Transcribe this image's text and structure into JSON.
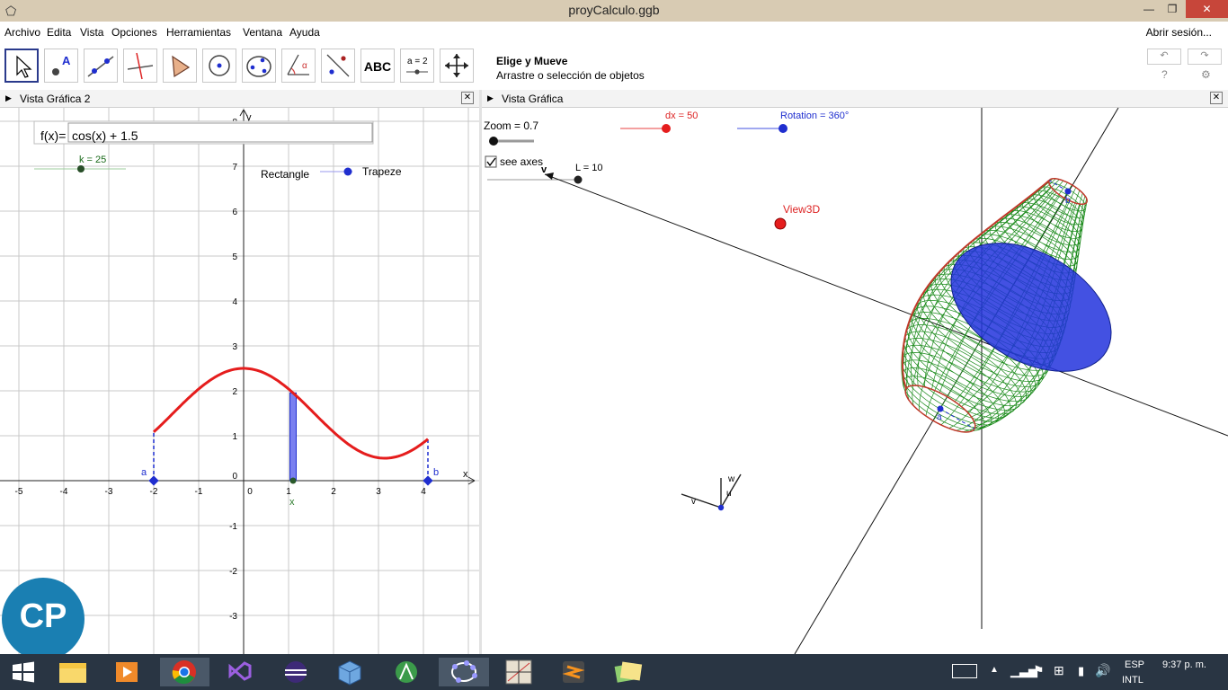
{
  "window": {
    "title": "proyCalculo.ggb",
    "minimize": "—",
    "restore": "❐",
    "close": "✕"
  },
  "menu": {
    "items": [
      "Archivo",
      "Edita",
      "Vista",
      "Opciones",
      "Herramientas",
      "Ventana",
      "Ayuda"
    ],
    "login": "Abrir sesión..."
  },
  "toolbar": {
    "tool_title": "Elige y Mueve",
    "tool_desc": "Arrastre o selección de objetos",
    "text_tool": "ABC",
    "slider_tool": "a = 2",
    "undo": "↶",
    "redo": "↷",
    "help": "?",
    "settings": "⚙"
  },
  "left_view": {
    "header": "Vista Gráfica 2",
    "input_label": "f(x)=",
    "input_value": "cos(x) + 1.5",
    "slider_k": "k = 25",
    "rect_label": "Rectangle",
    "trap_label": "Trapeze",
    "x_axis_name": "x",
    "y_axis_name": "y",
    "x_ticks": [
      "-5",
      "-4",
      "-3",
      "-2",
      "-1",
      "0",
      "1",
      "2",
      "3",
      "4"
    ],
    "y_ticks": [
      "8",
      "7",
      "6",
      "5",
      "4",
      "3",
      "2",
      "1",
      "0",
      "-1",
      "-2",
      "-3"
    ],
    "point_a": "a",
    "point_b": "b",
    "point_x": "x",
    "logo": "CP"
  },
  "right_view": {
    "header": "Vista Gráfica",
    "zoom": "Zoom = 0.7",
    "dx": "dx = 50",
    "rotation": "Rotation = 360°",
    "see_axes": "see axes",
    "L": "L = 10",
    "view3d": "View3D",
    "axis_v": "v",
    "axis_w": "w",
    "axis_u": "u",
    "point_a": "a",
    "point_b": "b"
  },
  "taskbar": {
    "lang1": "ESP",
    "lang2": "INTL",
    "time": "9:37 p. m."
  },
  "chart_data": {
    "type": "line",
    "function": "cos(x) + 1.5",
    "domain": [
      -2,
      4.1
    ],
    "xlim": [
      -5.5,
      5
    ],
    "ylim": [
      -3.5,
      8
    ],
    "series": [
      {
        "values": [
          [
            -2,
            1.08
          ],
          [
            -1.5,
            1.57
          ],
          [
            -1,
            2.04
          ],
          [
            -0.5,
            2.38
          ],
          [
            0,
            2.5
          ],
          [
            0.5,
            2.38
          ],
          [
            1,
            2.04
          ],
          [
            1.5,
            1.57
          ],
          [
            2,
            1.08
          ],
          [
            2.5,
            0.7
          ],
          [
            3,
            0.51
          ],
          [
            3.14,
            0.5
          ],
          [
            3.5,
            0.56
          ],
          [
            4,
            0.85
          ],
          [
            4.1,
            0.92
          ]
        ]
      }
    ],
    "highlight_x": 1.1
  },
  "colors": {
    "curve": "#e51d1d",
    "accent": "#1f2ecf",
    "mesh": "#1a8a1a",
    "taskbar": "#293543"
  }
}
